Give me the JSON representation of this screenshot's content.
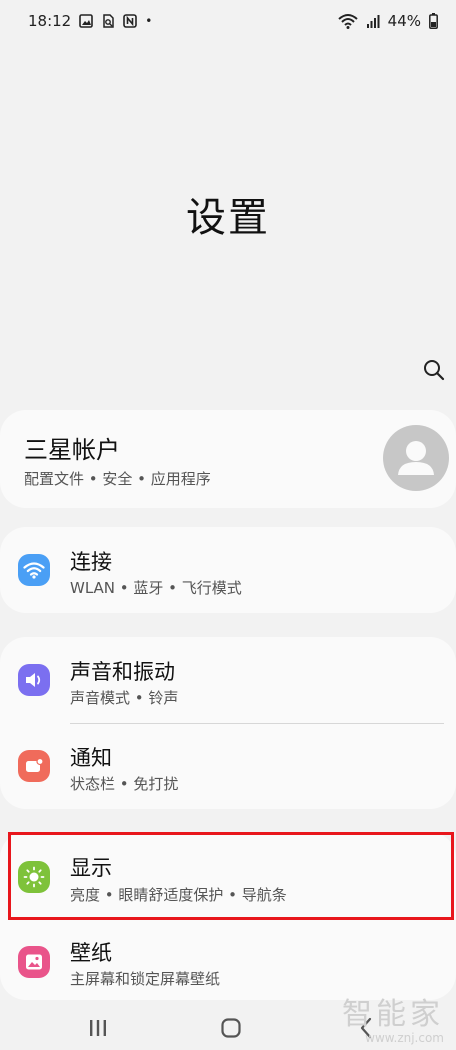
{
  "status_bar": {
    "time": "18:12",
    "dot": "•",
    "battery": "44%"
  },
  "header": {
    "title": "设置"
  },
  "account": {
    "title": "三星帐户",
    "subtitle": "配置文件 • 安全 • 应用程序"
  },
  "items": [
    {
      "key": "connections",
      "title": "连接",
      "subtitle": "WLAN • 蓝牙 • 飞行模式",
      "icon": "wifi-icon",
      "color": "#4a9ff5"
    },
    {
      "key": "sounds",
      "title": "声音和振动",
      "subtitle": "声音模式 • 铃声",
      "icon": "volume-icon",
      "color": "#7b6ff0"
    },
    {
      "key": "notifications",
      "title": "通知",
      "subtitle": "状态栏 • 免打扰",
      "icon": "notification-icon",
      "color": "#f06b5b"
    },
    {
      "key": "display",
      "title": "显示",
      "subtitle": "亮度 • 眼睛舒适度保护 • 导航条",
      "icon": "sun-icon",
      "color": "#7ec23a"
    },
    {
      "key": "wallpaper",
      "title": "壁纸",
      "subtitle": "主屏幕和锁定屏幕壁纸",
      "icon": "image-icon",
      "color": "#e9548a"
    }
  ],
  "highlight_color": "#e8161c",
  "watermark": {
    "brand": "智能家",
    "url": "www.znj.com"
  }
}
